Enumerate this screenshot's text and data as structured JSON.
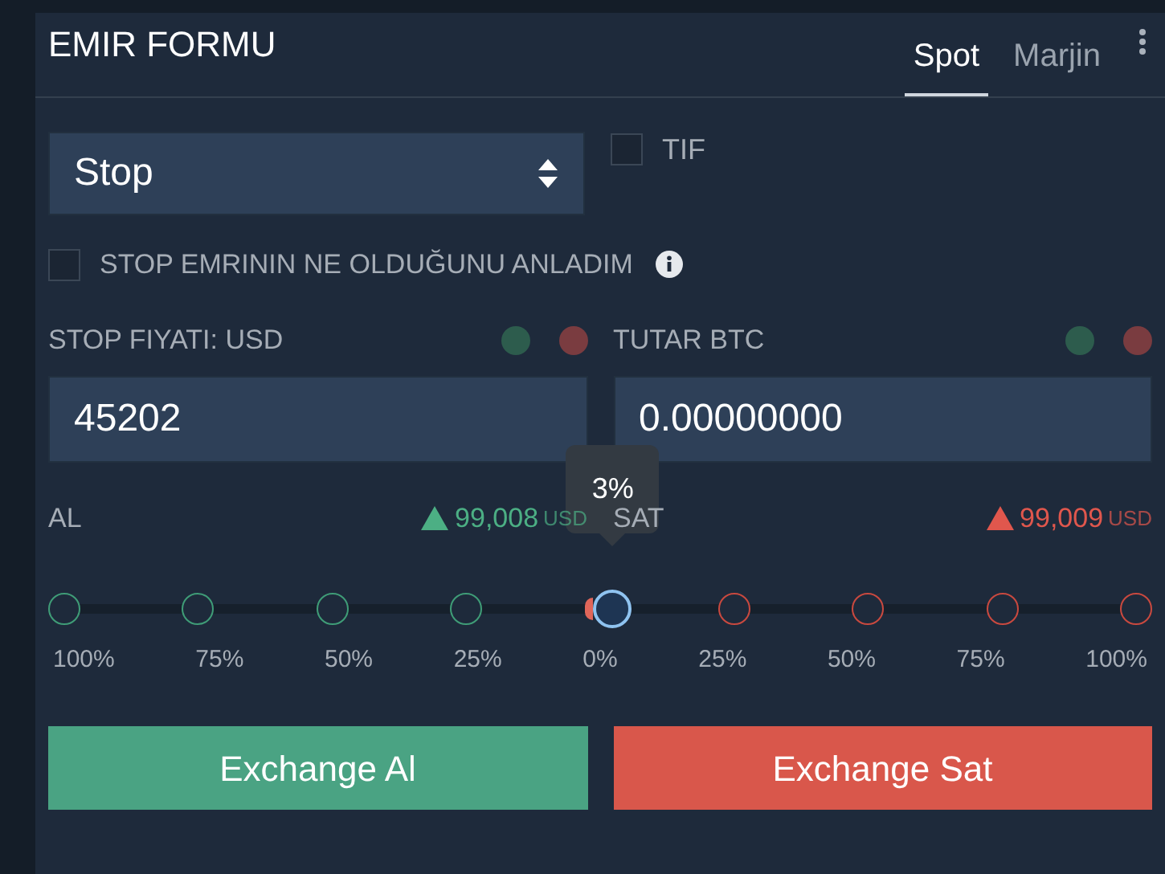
{
  "header": {
    "title": "EMIR FORMU",
    "tabs": [
      {
        "label": "Spot",
        "selected": true
      },
      {
        "label": "Marjin",
        "selected": false
      }
    ]
  },
  "order_type": {
    "value": "Stop"
  },
  "tif": {
    "label": "TIF",
    "checked": false
  },
  "acknowledge": {
    "label": "STOP EMRININ NE OLDUĞUNU ANLADIM",
    "checked": false
  },
  "fields": [
    {
      "label": "STOP FIYATI: USD",
      "value": "45202",
      "dots": [
        {
          "color": "#2d5c4d"
        },
        {
          "color": "#7a3c40"
        }
      ]
    },
    {
      "label": "TUTAR BTC",
      "value": "0.00000000",
      "dots": [
        {
          "color": "#2d5c4d"
        },
        {
          "color": "#7a3c40"
        }
      ]
    }
  ],
  "quotes": [
    {
      "kind": "buy",
      "label": "AL",
      "price": "99,008",
      "currency": "USD"
    },
    {
      "kind": "sell",
      "label": "SAT",
      "price": "99,009",
      "currency": "USD"
    }
  ],
  "slider": {
    "level": 0.515,
    "tooltip": "3%",
    "steps": [
      {
        "kind": "buy",
        "label": "100%"
      },
      {
        "kind": "buy",
        "label": "75%"
      },
      {
        "kind": "buy",
        "label": "50%"
      },
      {
        "kind": "buy",
        "label": "25%"
      },
      {
        "kind": "zero",
        "label": "0%"
      },
      {
        "kind": "sell",
        "label": "25%"
      },
      {
        "kind": "sell",
        "label": "50%"
      },
      {
        "kind": "sell",
        "label": "75%"
      },
      {
        "kind": "sell",
        "label": "100%"
      }
    ]
  },
  "buttons": [
    {
      "kind": "buy",
      "label": "Exchange Al"
    },
    {
      "kind": "sell",
      "label": "Exchange Sat"
    }
  ]
}
